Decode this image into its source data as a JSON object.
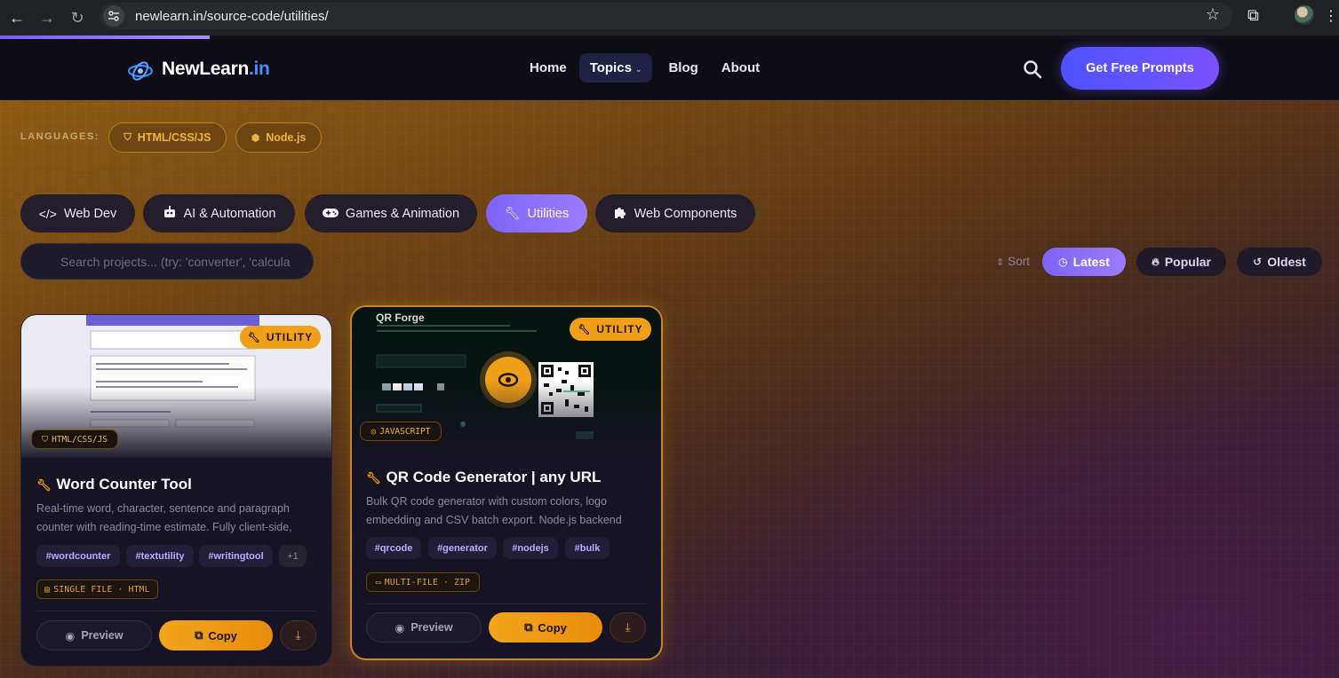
{
  "browser": {
    "url": "newlearn.in/source-code/utilities/"
  },
  "header": {
    "logo": {
      "name": "NewLearn",
      "tld": ".in"
    },
    "nav": [
      {
        "label": "Home"
      },
      {
        "label": "Topics",
        "caret": "⌄"
      },
      {
        "label": "Blog"
      },
      {
        "label": "About"
      }
    ],
    "cta_label": "Get Free Prompts"
  },
  "filters": {
    "languages_label": "LANGUAGES:",
    "languages": [
      {
        "label": "HTML/CSS/JS",
        "icon": "html5-icon"
      },
      {
        "label": "Node.js",
        "icon": "nodejs-icon"
      }
    ],
    "categories": [
      {
        "label": "Web Dev",
        "icon": "code-icon"
      },
      {
        "label": "AI & Automation",
        "icon": "robot-icon"
      },
      {
        "label": "Games & Animation",
        "icon": "gamepad-icon"
      },
      {
        "label": "Utilities",
        "icon": "wrench-icon",
        "active": true
      },
      {
        "label": "Web Components",
        "icon": "puzzle-icon"
      }
    ],
    "search_placeholder": "Search projects... (try: 'converter', 'calcula",
    "sort_label": "Sort",
    "sort_options": [
      {
        "label": "Latest",
        "icon": "clock-icon",
        "active": true
      },
      {
        "label": "Popular",
        "icon": "fire-icon"
      },
      {
        "label": "Oldest",
        "icon": "history-icon"
      }
    ]
  },
  "cards": [
    {
      "badge": "UTILITY",
      "lang": "HTML/CSS/JS",
      "title": "Word Counter Tool",
      "desc": "Real-time word, character, sentence and paragraph counter with reading-time estimate. Fully client-side, no...",
      "tags": [
        "#wordcounter",
        "#textutility",
        "#writingtool",
        "+1"
      ],
      "file": "SINGLE FILE · HTML",
      "preview_label": "Preview",
      "copy_label": "Copy"
    },
    {
      "badge": "UTILITY",
      "lang": "JAVASCRIPT",
      "thumb_title": "QR Forge",
      "title": "QR Code Generator | any URL",
      "desc": "Bulk QR code generator with custom colors, logo embedding and CSV batch export. Node.js backend with...",
      "tags": [
        "#qrcode",
        "#generator",
        "#nodejs",
        "#bulk"
      ],
      "file": "MULTI-FILE · ZIP",
      "preview_label": "Preview",
      "copy_label": "Copy"
    }
  ],
  "colors": {
    "accent": "#7d64f5",
    "brand_orange": "#f0a018",
    "cta_start": "#4b52ff",
    "cta_end": "#7b52ff"
  }
}
